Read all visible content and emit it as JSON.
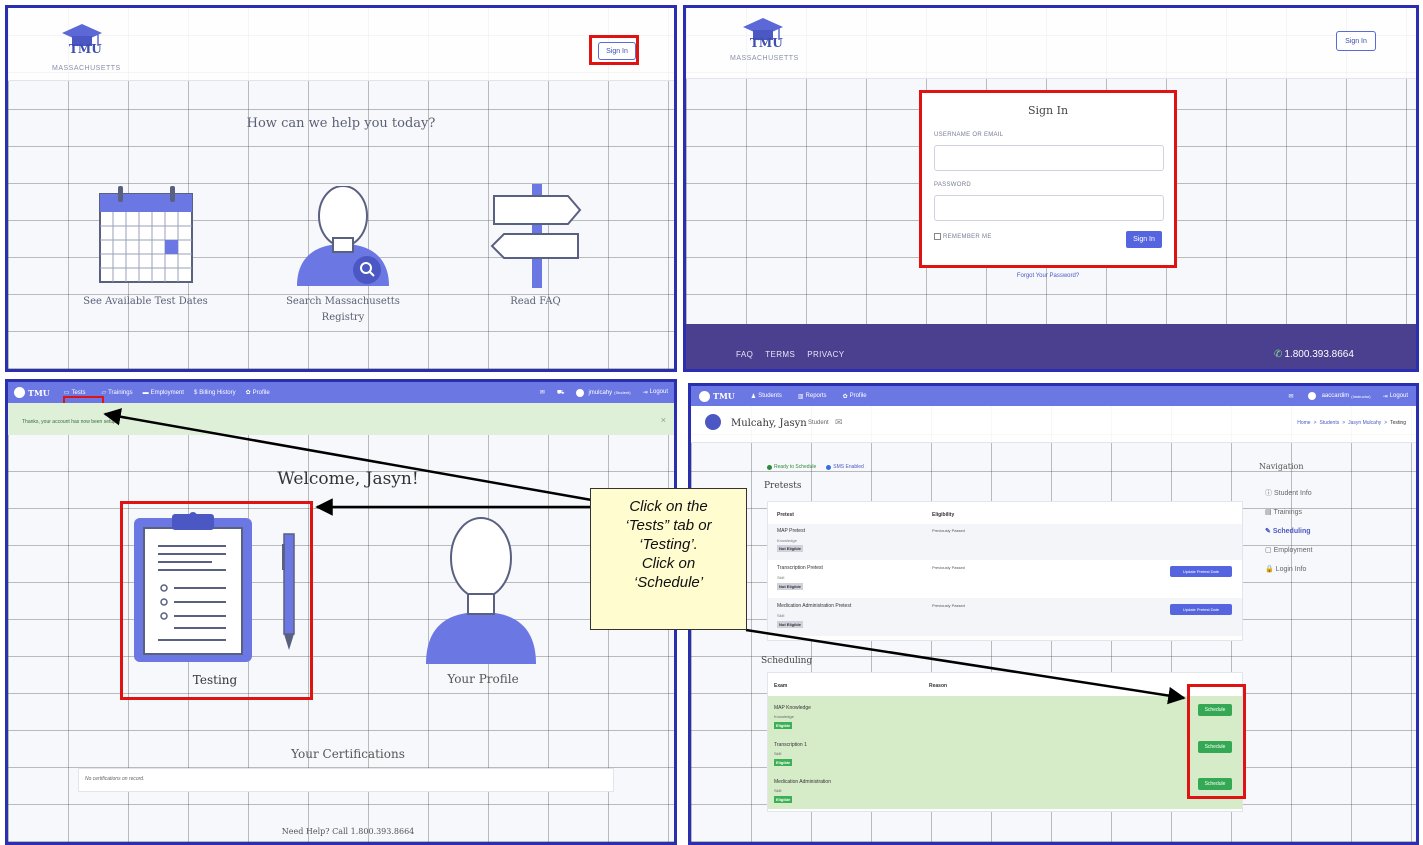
{
  "panel1": {
    "logo_text": "TMU",
    "logo_sub": "MASSACHUSETTS",
    "sign_in": "Sign In",
    "heading": "How can we help you today?",
    "options": [
      {
        "label_line1": "See Available Test Dates",
        "label_line2": ""
      },
      {
        "label_line1": "Search Massachusetts",
        "label_line2": "Registry"
      },
      {
        "label_line1": "Read FAQ",
        "label_line2": ""
      }
    ]
  },
  "panel2": {
    "logo_text": "TMU",
    "logo_sub": "MASSACHUSETTS",
    "sign_in_btn": "Sign In",
    "form_title": "Sign In",
    "username_label": "USERNAME OR EMAIL",
    "password_label": "PASSWORD",
    "remember_label": "REMEMBER ME",
    "submit": "Sign In",
    "forgot": "Forgot Your Password?",
    "footer_links": [
      "FAQ",
      "TERMS",
      "PRIVACY"
    ],
    "phone": "1.800.393.8664"
  },
  "panel3": {
    "brand": "TMU",
    "nav": [
      "Tests",
      "Trainings",
      "Employment",
      "Billing History",
      "Profile"
    ],
    "user": "jmulcahy",
    "user_role": "(Student)",
    "logout": "Logout",
    "alert": "Thanks, your account has now been setup.",
    "alert_close": "×",
    "welcome": "Welcome, Jasyn!",
    "tile_testing": "Testing",
    "tile_profile": "Your Profile",
    "certs_title": "Your Certifications",
    "certs_empty": "No certifications on record.",
    "help": "Need Help? Call 1.800.393.8664"
  },
  "panel4": {
    "brand": "TMU",
    "nav": [
      "Students",
      "Reports",
      "Profile"
    ],
    "user": "aaccardim",
    "user_role": "(Instructor)",
    "logout": "Logout",
    "student_name": "Mulcahy, Jasyn",
    "student_tag": "Student",
    "breadcrumb": [
      "Home",
      "Students",
      "Jasyn Mulcahy",
      "Testing"
    ],
    "status_ready": "Ready to Schedule",
    "status_sms": "SMS Enabled",
    "pretests_title": "Pretests",
    "pretest_headers": [
      "Pretest",
      "Eligibility"
    ],
    "pretests": [
      {
        "name": "MAP Pretest",
        "type": "Knowledge",
        "badge": "Not Eligible",
        "eligibility": "Previously Passed",
        "action": ""
      },
      {
        "name": "Transcription Pretest",
        "type": "Skill",
        "badge": "Not Eligible",
        "eligibility": "Previously Passed",
        "action": "Update Pretest Date"
      },
      {
        "name": "Medication Administration Pretest",
        "type": "Skill",
        "badge": "Not Eligible",
        "eligibility": "Previously Passed",
        "action": "Update Pretest Date"
      }
    ],
    "scheduling_title": "Scheduling",
    "sched_headers": [
      "Exam",
      "Reason"
    ],
    "exams": [
      {
        "name": "MAP Knowledge",
        "type": "Knowledge",
        "badge": "Eligible",
        "action": "Schedule"
      },
      {
        "name": "Transcription 1",
        "type": "Skill",
        "badge": "Eligible",
        "action": "Schedule"
      },
      {
        "name": "Medication Administration",
        "type": "Skill",
        "badge": "Eligible",
        "action": "Schedule"
      }
    ],
    "side_title": "Navigation",
    "side_items": [
      "Student Info",
      "Trainings",
      "Scheduling",
      "Employment",
      "Login Info"
    ]
  },
  "callout": {
    "lines": [
      "Click on the",
      "‘Tests” tab or",
      "‘Testing’.",
      "Click on",
      "‘Schedule’"
    ]
  },
  "colors": {
    "nav": "#6b77e3",
    "footer": "#4b3f8f",
    "annotation_red": "#e01313",
    "panel_border": "#2a2fb0",
    "eligible_green": "#3bb054"
  }
}
